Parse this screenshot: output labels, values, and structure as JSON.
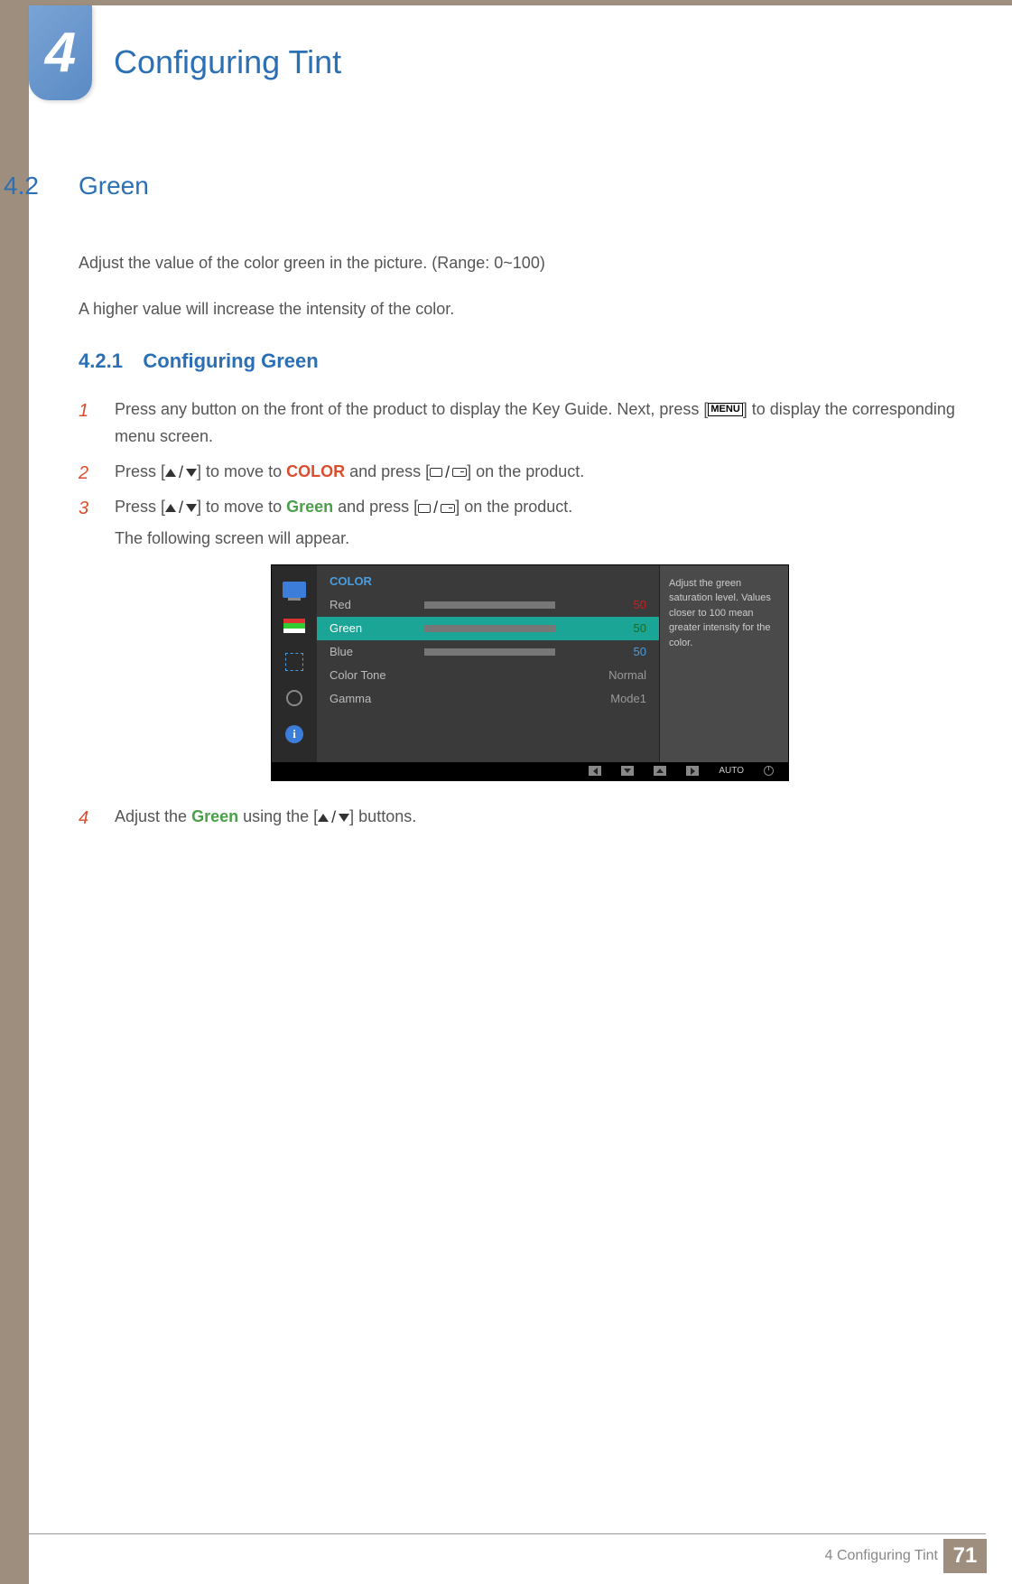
{
  "chapter_badge": "4",
  "page_title": "Configuring Tint",
  "section": {
    "num": "4.2",
    "title": "Green"
  },
  "intro": [
    "Adjust the value of the color green in the picture. (Range: 0~100)",
    "A higher value will increase the intensity of the color."
  ],
  "subsection": {
    "num": "4.2.1",
    "title": "Configuring Green"
  },
  "steps": {
    "s1": {
      "num": "1",
      "pre": "Press any button on the front of the product to display the Key Guide. Next, press [",
      "menu": "MENU",
      "post": "] to display the corresponding menu screen."
    },
    "s2": {
      "num": "2",
      "a": "Press [",
      "b": "] to move to ",
      "term": "COLOR",
      "c": " and press [",
      "d": "] on the product."
    },
    "s3": {
      "num": "3",
      "a": "Press [",
      "b": "] to move to ",
      "term": "Green",
      "c": " and press [",
      "d": "] on the product.",
      "extra": "The following screen will appear."
    },
    "s4": {
      "num": "4",
      "a": "Adjust the ",
      "term": "Green",
      "b": " using the [",
      "c": "] buttons."
    }
  },
  "osd": {
    "title": "COLOR",
    "rows": {
      "red": {
        "label": "Red",
        "val": "50",
        "pct": 50
      },
      "green": {
        "label": "Green",
        "val": "50",
        "pct": 50
      },
      "blue": {
        "label": "Blue",
        "val": "50",
        "pct": 50
      },
      "tone": {
        "label": "Color Tone",
        "val": "Normal"
      },
      "gamma": {
        "label": "Gamma",
        "val": "Mode1"
      }
    },
    "help": "Adjust the green saturation level. Values closer to 100 mean greater intensity for the color.",
    "bottom": {
      "auto": "AUTO"
    },
    "info_glyph": "i"
  },
  "footer": {
    "chapter": "4 Configuring Tint",
    "page": "71"
  }
}
